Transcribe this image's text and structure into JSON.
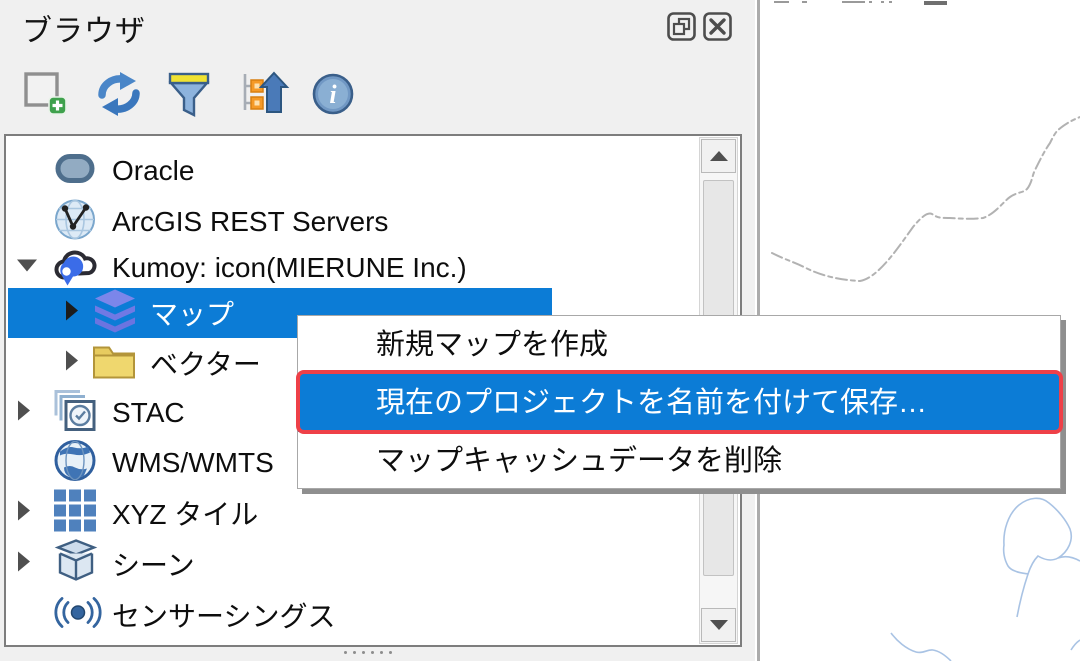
{
  "panel": {
    "title": "ブラウザ",
    "window_buttons": [
      {
        "icon": "float-panel-icon"
      },
      {
        "icon": "close-panel-icon"
      }
    ]
  },
  "toolbar": {
    "buttons": [
      {
        "icon": "add-layer-icon"
      },
      {
        "icon": "refresh-icon"
      },
      {
        "icon": "filter-icon"
      },
      {
        "icon": "collapse-tree-icon"
      },
      {
        "icon": "info-icon"
      }
    ]
  },
  "tree": {
    "items": [
      {
        "label": "Oracle",
        "icon": "oracle-icon",
        "level": 0,
        "expander": "none",
        "selected": false
      },
      {
        "label": "ArcGIS REST Servers",
        "icon": "arcgis-icon",
        "level": 0,
        "expander": "none",
        "selected": false
      },
      {
        "label": "Kumoy: icon(MIERUNE Inc.)",
        "icon": "cloud-pin-icon",
        "level": 0,
        "expander": "expanded",
        "selected": false
      },
      {
        "label": "マップ",
        "icon": "layers-icon",
        "level": 1,
        "expander": "collapsed",
        "selected": true
      },
      {
        "label": "ベクター",
        "icon": "folder-icon",
        "level": 1,
        "expander": "collapsed",
        "selected": false
      },
      {
        "label": "STAC",
        "icon": "stac-icon",
        "level": 0,
        "expander": "collapsed",
        "selected": false
      },
      {
        "label": "WMS/WMTS",
        "icon": "wms-globe-icon",
        "level": 0,
        "expander": "none",
        "selected": false
      },
      {
        "label": "XYZ タイル",
        "icon": "xyz-tiles-icon",
        "level": 0,
        "expander": "collapsed",
        "selected": false
      },
      {
        "label": "シーン",
        "icon": "scene-cube-icon",
        "level": 0,
        "expander": "collapsed",
        "selected": false
      },
      {
        "label": "センサーシングス",
        "icon": "sensorthings-icon",
        "level": 0,
        "expander": "none",
        "selected": false
      }
    ]
  },
  "context_menu": {
    "items": [
      {
        "label": "新規マップを作成",
        "highlighted": false
      },
      {
        "label": "現在のプロジェクトを名前を付けて保存…",
        "highlighted": true,
        "annotated": true
      },
      {
        "label": "マップキャッシュデータを削除",
        "highlighted": false
      }
    ]
  },
  "colors": {
    "selection_blue": "#0c7cd6",
    "annotation_red": "#ee4048",
    "panel_background": "#f0f0f0"
  }
}
